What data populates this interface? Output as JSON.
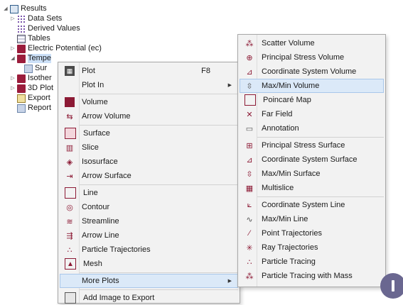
{
  "tree": {
    "results": "Results",
    "data_sets": "Data Sets",
    "derived_values": "Derived Values",
    "tables": "Tables",
    "electric_potential": "Electric Potential (ec)",
    "temperature_partial": "Tempe",
    "surface_partial": "Sur",
    "isothermal_partial": "Isother",
    "plot3d_partial": "3D Plot",
    "export_partial": "Export",
    "reports_partial": "Report"
  },
  "context_menu": {
    "items": [
      {
        "label": "Plot",
        "shortcut": "F8",
        "icon": "plot-icon"
      },
      {
        "label": "Plot In",
        "submenu": true
      },
      {
        "label": "Volume",
        "icon": "volume-icon"
      },
      {
        "label": "Arrow Volume",
        "icon": "arrow-volume-icon"
      },
      {
        "label": "Surface",
        "icon": "surface-icon"
      },
      {
        "label": "Slice",
        "icon": "slice-icon"
      },
      {
        "label": "Isosurface",
        "icon": "isosurface-icon"
      },
      {
        "label": "Arrow Surface",
        "icon": "arrow-surface-icon"
      },
      {
        "label": "Line",
        "icon": "line-icon"
      },
      {
        "label": "Contour",
        "icon": "contour-icon"
      },
      {
        "label": "Streamline",
        "icon": "streamline-icon"
      },
      {
        "label": "Arrow Line",
        "icon": "arrow-line-icon"
      },
      {
        "label": "Particle Trajectories",
        "icon": "particle-trajectories-icon"
      },
      {
        "label": "Mesh",
        "icon": "mesh-icon"
      },
      {
        "label": "More Plots",
        "submenu": true,
        "highlighted": true
      },
      {
        "label": "Add Image to Export",
        "icon": "add-image-icon"
      }
    ]
  },
  "submenu": {
    "items": [
      {
        "label": "Scatter Volume",
        "icon": "scatter-volume-icon"
      },
      {
        "label": "Principal Stress Volume",
        "icon": "principal-stress-volume-icon"
      },
      {
        "label": "Coordinate System Volume",
        "icon": "coordinate-system-volume-icon"
      },
      {
        "label": "Max/Min Volume",
        "icon": "maxmin-volume-icon",
        "highlighted": true
      },
      {
        "label": "Poincaré Map",
        "icon": "poincare-map-icon"
      },
      {
        "label": "Far Field",
        "icon": "far-field-icon"
      },
      {
        "label": "Annotation",
        "icon": "annotation-icon"
      },
      {
        "label": "Principal Stress Surface",
        "icon": "principal-stress-surface-icon"
      },
      {
        "label": "Coordinate System Surface",
        "icon": "coordinate-system-surface-icon"
      },
      {
        "label": "Max/Min Surface",
        "icon": "maxmin-surface-icon"
      },
      {
        "label": "Multislice",
        "icon": "multislice-icon"
      },
      {
        "label": "Coordinate System Line",
        "icon": "coordinate-system-line-icon"
      },
      {
        "label": "Max/Min Line",
        "icon": "maxmin-line-icon"
      },
      {
        "label": "Point Trajectories",
        "icon": "point-trajectories-icon"
      },
      {
        "label": "Ray Trajectories",
        "icon": "ray-trajectories-icon"
      },
      {
        "label": "Particle Tracing",
        "icon": "particle-tracing-icon"
      },
      {
        "label": "Particle Tracing with Mass",
        "icon": "particle-tracing-mass-icon"
      }
    ]
  },
  "colors": {
    "menu_bg": "#f2f2f2",
    "highlight_bg": "#dbe9f8",
    "highlight_border": "#a9c7ea",
    "plot_accent": "#9b1d3c",
    "badge": "#6a6790"
  }
}
